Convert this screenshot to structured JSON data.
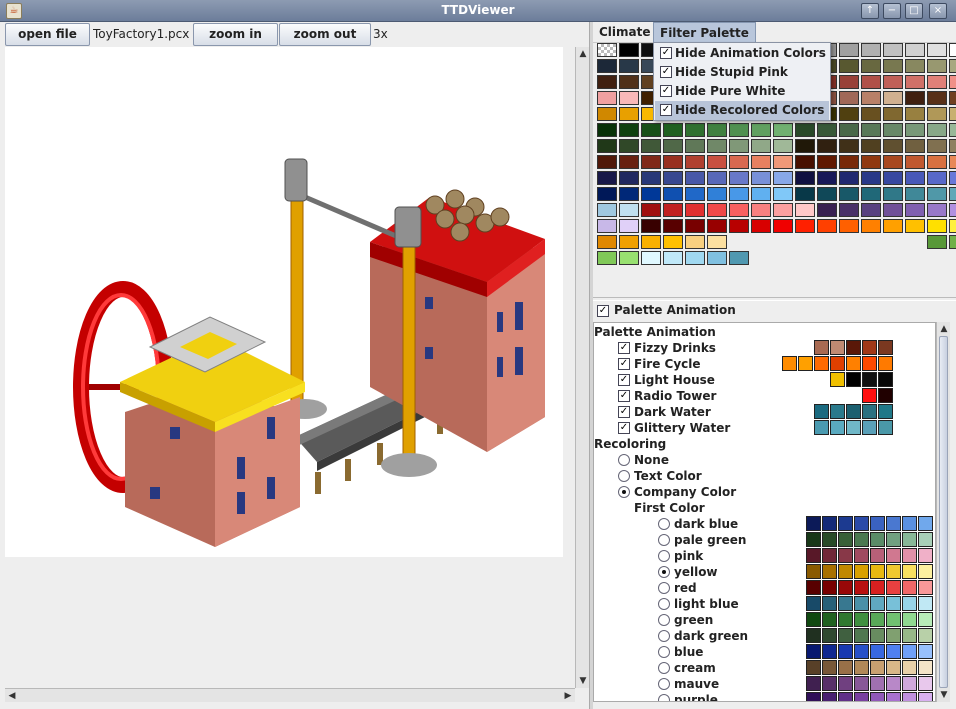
{
  "window": {
    "title": "TTDViewer",
    "buttons": [
      "↑",
      "−",
      "□",
      "×"
    ]
  },
  "toolbar": {
    "open_label": "open file",
    "filename": "ToyFactory1.pcx",
    "zoom_in_label": "zoom in",
    "zoom_out_label": "zoom out",
    "zoom_level": "3x"
  },
  "menu": {
    "climate": "Climate",
    "filter": "Filter Palette"
  },
  "filter_menu": [
    {
      "label": "Hide Animation Colors",
      "checked": true
    },
    {
      "label": "Hide Stupid Pink",
      "checked": true
    },
    {
      "label": "Hide Pure White",
      "checked": true
    },
    {
      "label": "Hide Recolored Colors",
      "checked": true,
      "highlighted": true
    }
  ],
  "palette_animation_toggle": "Palette Animation",
  "tree": {
    "animation_header": "Palette Animation",
    "animations": [
      {
        "label": "Fizzy Drinks",
        "colors": [
          "#a86a52",
          "#c08a72",
          "#5a1808",
          "#a03818",
          "#7a3820"
        ]
      },
      {
        "label": "Fire Cycle",
        "colors": [
          "#ff8c00",
          "#ffa000",
          "#ff6a00",
          "#e04000",
          "#ff8000",
          "#ff4a00",
          "#ff7a00"
        ]
      },
      {
        "label": "Light House",
        "colors": [
          "#f0c000",
          "#000000",
          "#101010",
          "#080808"
        ]
      },
      {
        "label": "Radio Tower",
        "colors": [
          "#ff1010",
          "#200000"
        ]
      },
      {
        "label": "Dark Water",
        "colors": [
          "#1a6a80",
          "#2a7a8c",
          "#1c6070",
          "#2a7080",
          "#207888"
        ]
      },
      {
        "label": "Glittery Water",
        "colors": [
          "#4a9ab0",
          "#5aaac0",
          "#70b8c8",
          "#5aa0b8",
          "#4a98a8"
        ]
      }
    ],
    "recoloring_header": "Recoloring",
    "recolor_options": [
      {
        "label": "None",
        "selected": false
      },
      {
        "label": "Text Color",
        "selected": false
      },
      {
        "label": "Company Color",
        "selected": true
      }
    ],
    "first_color_header": "First Color",
    "colors": [
      {
        "label": "dark blue",
        "selected": false,
        "ramp": [
          "#0c1a58",
          "#142a78",
          "#1c3a90",
          "#2a4aa8",
          "#3a62c0",
          "#4a78d0",
          "#5a90e0",
          "#70a8ec"
        ]
      },
      {
        "label": "pale green",
        "selected": false,
        "ramp": [
          "#183818",
          "#284a28",
          "#386038",
          "#4a7850",
          "#5a8c68",
          "#70a080",
          "#88b898",
          "#a8d0b8"
        ]
      },
      {
        "label": "pink",
        "selected": false,
        "ramp": [
          "#581828",
          "#702838",
          "#883848",
          "#a04a60",
          "#b86078",
          "#d07890",
          "#e090a8",
          "#f0b0c8"
        ]
      },
      {
        "label": "yellow",
        "selected": true,
        "ramp": [
          "#8a5a00",
          "#a87000",
          "#c08800",
          "#d8a000",
          "#e8b810",
          "#f0c830",
          "#f8e060",
          "#fcf0a0"
        ]
      },
      {
        "label": "red",
        "selected": false,
        "ramp": [
          "#580000",
          "#780000",
          "#980808",
          "#b81010",
          "#d82020",
          "#e84040",
          "#f06868",
          "#f89898"
        ]
      },
      {
        "label": "light blue",
        "selected": false,
        "ramp": [
          "#184a68",
          "#286078",
          "#387890",
          "#4a90a8",
          "#60a8c0",
          "#78c0d8",
          "#98d4e8",
          "#c0e8f4"
        ]
      },
      {
        "label": "green",
        "selected": false,
        "ramp": [
          "#104810",
          "#206020",
          "#307830",
          "#409040",
          "#58a858",
          "#70c070",
          "#90d890",
          "#b8ecb8"
        ]
      },
      {
        "label": "dark green",
        "selected": false,
        "ramp": [
          "#203020",
          "#304830",
          "#406040",
          "#507850",
          "#688c60",
          "#80a070",
          "#98b888",
          "#b8d0a8"
        ]
      },
      {
        "label": "blue",
        "selected": false,
        "ramp": [
          "#081870",
          "#102890",
          "#1838b0",
          "#2850c8",
          "#3868e0",
          "#5080f0",
          "#70a0f8",
          "#98c0fc"
        ]
      },
      {
        "label": "cream",
        "selected": false,
        "ramp": [
          "#584028",
          "#785838",
          "#987048",
          "#b08858",
          "#c8a070",
          "#d8b888",
          "#e8d0a8",
          "#f4e4c8"
        ]
      },
      {
        "label": "mauve",
        "selected": false,
        "ramp": [
          "#402050",
          "#583068",
          "#704080",
          "#885898",
          "#a070b0",
          "#b888c8",
          "#d0a8dc",
          "#e8c8ec"
        ]
      },
      {
        "label": "purple",
        "selected": false,
        "ramp": [
          "#301058",
          "#482070",
          "#603088",
          "#7840a0",
          "#9058b8",
          "#a870d0",
          "#c090e0",
          "#d8b0f0"
        ]
      }
    ]
  },
  "palette_rows": [
    [
      "#c8c8c8",
      "#000000",
      "#101010",
      "#202020",
      "#303030",
      "#404040",
      "#505050",
      "#606060",
      "#707070",
      "#808080",
      "#909090",
      "#a0a0a0",
      "#b0b0b0",
      "#c0c0c0",
      "#d0d0d0",
      "#e0e0e0",
      "#ffffff"
    ],
    [
      "#1c2838",
      "#283848",
      "#384858",
      "#485868",
      "#586878",
      "#6878888",
      "#788898",
      "#8898a8",
      "#98a8b8",
      "#38381c",
      "#484828",
      "#585830",
      "#686840",
      "#787850",
      "#888860",
      "#989870",
      "#a8a880"
    ],
    [
      "#402010",
      "#503018",
      "#604020",
      "#705028",
      "#806038",
      "#907048",
      "#a08058",
      "#b09068",
      "#c0a080",
      "#682020",
      "#803028",
      "#984038",
      "#b05048",
      "#c06058",
      "#d07068",
      "#e08078",
      "#f09088"
    ],
    [
      "#f0a0a0",
      "#f8b8b8",
      "#402000",
      "#603000",
      "#804008",
      "#a05010",
      "#b86820",
      "#d08030",
      "#e09848",
      "#f8b060",
      "#885040",
      "#a06858",
      "#b88068",
      "#d0b090",
      "#402010",
      "#583018",
      "#704020"
    ],
    [
      "#d08800",
      "#e8a000",
      "#f8b800",
      "#683818",
      "#804828",
      "#986038",
      "#b07850",
      "#c89068",
      "#d8a880",
      "#e8c8a0",
      "#383000",
      "#504010",
      "#685020",
      "#806830",
      "#988040",
      "#b09858",
      "#c8b070"
    ],
    [
      "#083008",
      "#104010",
      "#185018",
      "#206020",
      "#307030",
      "#408040",
      "#509050",
      "#60a060",
      "#70b070",
      "#284828",
      "#385838",
      "#486848",
      "#587858",
      "#688868",
      "#789878",
      "#88a888",
      "#98b898"
    ],
    [
      "#203818",
      "#304828",
      "#405838",
      "#506848",
      "#607858",
      "#708868",
      "#809878",
      "#90a888",
      "#a0b898",
      "#201808",
      "#302010",
      "#403018",
      "#504020",
      "#605030",
      "#706040",
      "#807050",
      "#908060"
    ],
    [
      "#501808",
      "#682010",
      "#802818",
      "#983020",
      "#b04030",
      "#c85040",
      "#d86850",
      "#e88060",
      "#f09878",
      "#481000",
      "#601800",
      "#782808",
      "#903810",
      "#a84820",
      "#c05830",
      "#d87040",
      "#e88858"
    ],
    [
      "#181848",
      "#202860",
      "#283878",
      "#384890",
      "#4858a8",
      "#5868b8",
      "#6878c8",
      "#7890d8",
      "#88a8e8",
      "#101040",
      "#181858",
      "#202870",
      "#283888",
      "#3848a0",
      "#4858b8",
      "#5868c8",
      "#6878d8"
    ],
    [
      "#001858",
      "#002878",
      "#003898",
      "#1050b0",
      "#2068c8",
      "#3080d8",
      "#4898e8",
      "#60b0f0",
      "#80c8f8",
      "#083848",
      "#104858",
      "#185868",
      "#206878",
      "#307888",
      "#408898",
      "#5098a8",
      "#60a8b8"
    ],
    [
      "#a0c8e0",
      "#c0e0f0",
      "#a01010",
      "#c02020",
      "#e03030",
      "#f04848",
      "#f86060",
      "#f88080",
      "#fca0a0",
      "#ffc8c8",
      "#382050",
      "#483068",
      "#584080",
      "#705098",
      "#8060b0",
      "#9878c8",
      "#b090e0"
    ],
    [
      "#c8b8e8",
      "#e0d0f8",
      "#380000",
      "#580000",
      "#780000",
      "#980000",
      "#b80000",
      "#d80000",
      "#f00000",
      "#ff2000",
      "#ff4000",
      "#ff6000",
      "#ff8000",
      "#ffa000",
      "#ffc000",
      "#ffe000",
      "#fff040"
    ],
    [
      "#e08800",
      "#f0a000",
      "#f8b000",
      "#ffc000",
      "#f8d080",
      "#fce0a0",
      "",
      "",
      "",
      "",
      "",
      "",
      "",
      "",
      "",
      "#589838",
      "#70b048"
    ],
    [
      "#80c858",
      "#98e070",
      "#e0f8ff",
      "#c0e8f8",
      "#a0d8f0",
      "#80c0e0",
      "#5098b0",
      "",
      "",
      "",
      "",
      "",
      "",
      "",
      "",
      "",
      ""
    ]
  ]
}
